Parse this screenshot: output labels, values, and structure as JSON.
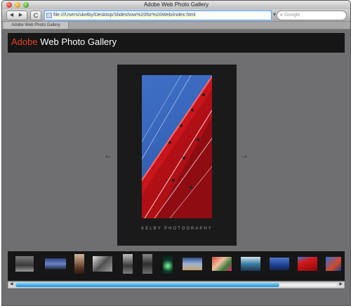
{
  "window": {
    "title": "Adobe Web Photo Gallery"
  },
  "toolbar": {
    "back_label": "◀",
    "forward_label": "▶",
    "reload_label": "C",
    "url": "file:///Users/skelby/Desktop/Slideshow%20for%20Web/index.html",
    "search_placeholder": "Google"
  },
  "tab": {
    "label": "Adobe Web Photo Gallery"
  },
  "header": {
    "brand": "Adobe",
    "title_rest": " Web Photo Gallery",
    "brand_color": "#e4451f"
  },
  "viewer": {
    "prev_label": "←",
    "next_label": "→",
    "caption": "KELBY PHOTOGRAPHY",
    "photo_subject": "red-sail-and-rigging-photo"
  },
  "filmstrip": {
    "thumbnails": [
      "rock-landscape-thumbnail",
      "sky-horizon-thumbnail",
      "portrait-figure-thumbnail",
      "branches-silhouette-thumbnail",
      "dark-street-thumbnail",
      "dim-hallway-thumbnail",
      "green-light-thumbnail",
      "sunset-water-thumbnail",
      "flower-market-thumbnail",
      "harbor-boats-thumbnail",
      "blue-sea-thumbnail",
      "red-sail-thumbnail",
      "blue-tile-thumbnail"
    ],
    "scroll_fraction": 0.82,
    "accent_color": "#1e8fd3"
  }
}
